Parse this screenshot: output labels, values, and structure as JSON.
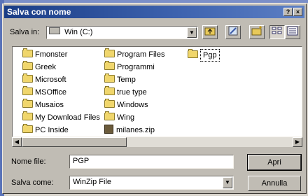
{
  "window": {
    "title": "Salva con nome"
  },
  "titlebar_buttons": {
    "help": "?",
    "close": "×"
  },
  "toolbar": {
    "save_in_label": "Salva in:",
    "location": "Win (C:)",
    "location_icon": "drive-icon"
  },
  "files": {
    "col1": [
      "Fmonster",
      "Greek",
      "Microsoft",
      "MSOffice",
      "Musaios",
      "My Download Files",
      "PC Inside"
    ],
    "col2": [
      "Program Files",
      "Programmi",
      "Temp",
      "true type",
      "Windows",
      "Wing"
    ],
    "col2_file": "milanes.zip",
    "col3": [
      "Pgp"
    ]
  },
  "form": {
    "filename_label": "Nome file:",
    "filename_value": "PGP",
    "savetype_label": "Salva come:",
    "savetype_value": "WinZip File"
  },
  "buttons": {
    "save": "Apri",
    "cancel": "Annulla"
  }
}
